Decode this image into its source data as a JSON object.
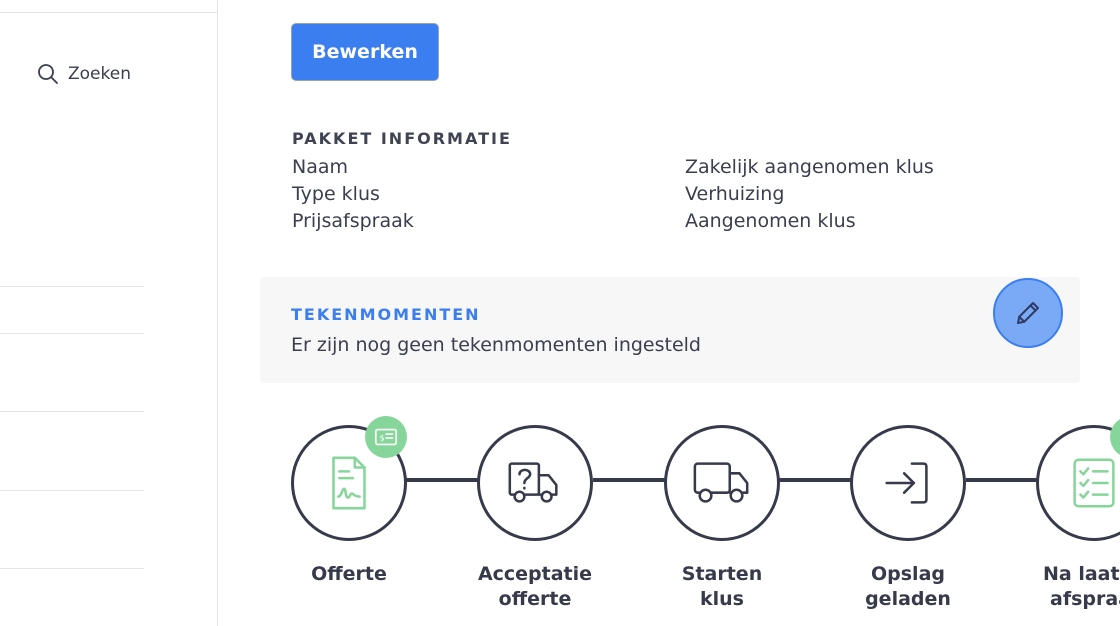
{
  "sidebar": {
    "search_label": "Zoeken"
  },
  "toolbar": {
    "edit_label": "Bewerken"
  },
  "pakket": {
    "title": "PAKKET INFORMATIE",
    "rows": [
      {
        "key": "Naam",
        "value": "Zakelijk aangenomen klus"
      },
      {
        "key": "Type klus",
        "value": "Verhuizing"
      },
      {
        "key": "Prijsafspraak",
        "value": "Aangenomen klus"
      }
    ]
  },
  "tekenmomenten": {
    "title": "TEKENMOMENTEN",
    "text": "Er zijn nog geen tekenmomenten ingesteld"
  },
  "timeline": {
    "steps": [
      {
        "line1": "Offerte",
        "line2": "",
        "icon": "document-green-icon"
      },
      {
        "line1": "Acceptatie",
        "line2": "offerte",
        "icon": "truck-question-icon"
      },
      {
        "line1": "Starten",
        "line2": "klus",
        "icon": "truck-icon"
      },
      {
        "line1": "Opslag",
        "line2": "geladen",
        "icon": "sign-in-icon"
      },
      {
        "line1": "Na laats",
        "line2": "afspraa",
        "icon": "checklist-green-icon"
      }
    ]
  },
  "colors": {
    "accent": "#3b7ef0",
    "green": "#86d59a",
    "text": "#363a4a"
  }
}
